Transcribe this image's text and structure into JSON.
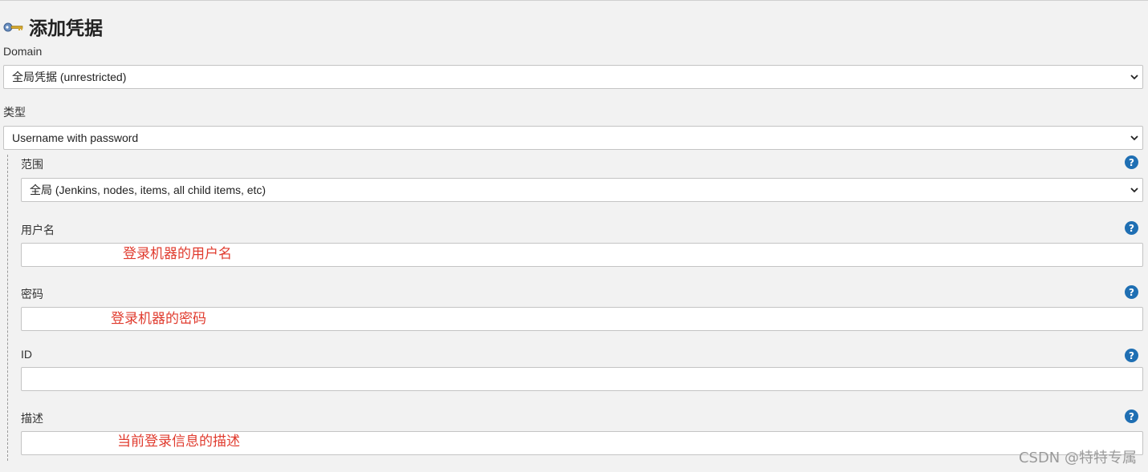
{
  "page": {
    "title": "添加凭据",
    "title_icon": "key-icon"
  },
  "domain": {
    "label": "Domain",
    "selected": "全局凭据 (unrestricted)"
  },
  "kind": {
    "label": "类型",
    "selected": "Username with password"
  },
  "scope": {
    "label": "范围",
    "selected": "全局 (Jenkins, nodes, items, all child items, etc)",
    "help": "?"
  },
  "username": {
    "label": "用户名",
    "value": "",
    "help": "?",
    "annotation": "登录机器的用户名"
  },
  "password": {
    "label": "密码",
    "value": "",
    "help": "?",
    "annotation": "登录机器的密码"
  },
  "id": {
    "label": "ID",
    "value": "",
    "help": "?"
  },
  "description": {
    "label": "描述",
    "value": "",
    "help": "?",
    "annotation": "当前登录信息的描述"
  },
  "watermark": "CSDN @特特专属",
  "colors": {
    "help_icon": "#1f6fb3",
    "annotation": "#e03b2e",
    "background": "#f2f2f2"
  }
}
